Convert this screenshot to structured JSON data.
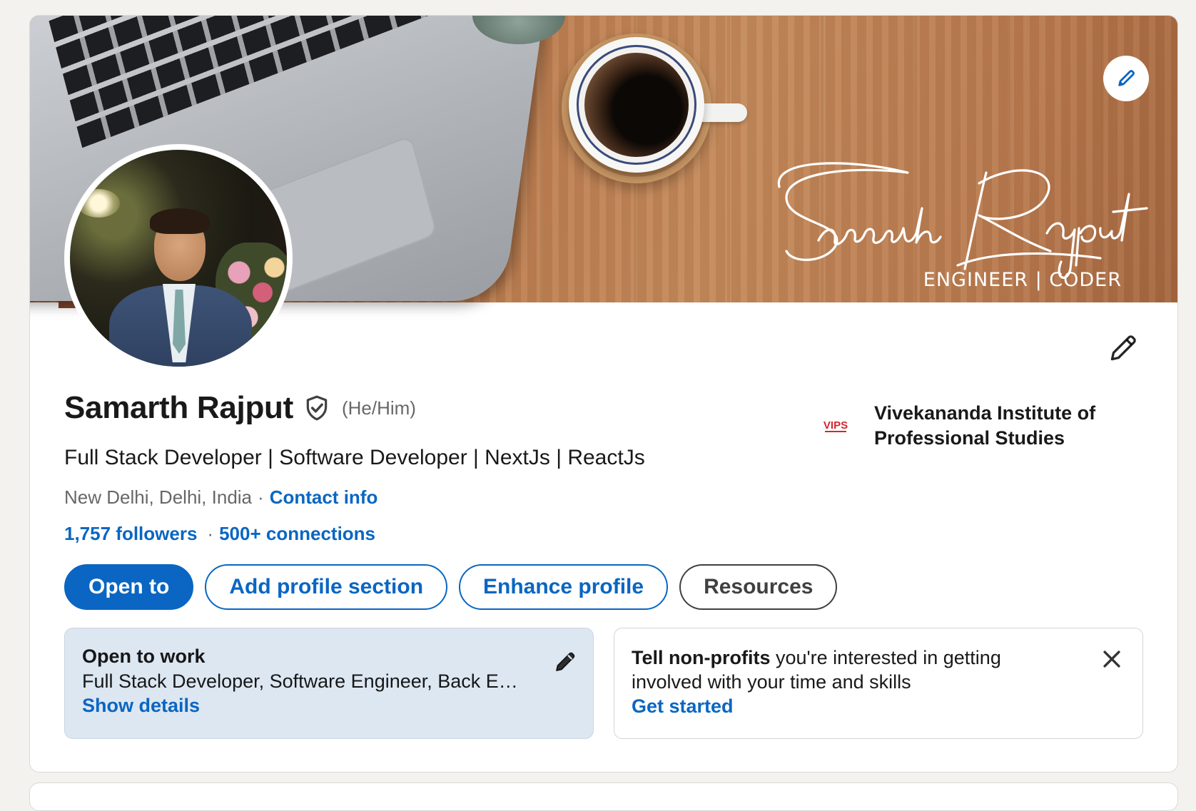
{
  "banner": {
    "signature_name": "Samarth Rajput",
    "signature_tagline": "ENGINEER | CODER",
    "edit_icon": "pencil-icon"
  },
  "profile": {
    "name": "Samarth Rajput",
    "verified_icon": "verified-shield-icon",
    "pronouns": "(He/Him)",
    "headline": "Full Stack Developer | Software Developer | NextJs | ReactJs",
    "location": "New Delhi, Delhi, India",
    "location_separator": "·",
    "contact_label": "Contact info",
    "followers_label": "1,757 followers",
    "connections_separator": "·",
    "connections_label": "500+ connections",
    "edit_icon": "pencil-icon"
  },
  "education": {
    "logo_text": "VIPS",
    "school_name": "Vivekananda Institute of Professional Studies"
  },
  "actions": {
    "open_to": "Open to",
    "add_section": "Add profile section",
    "enhance": "Enhance profile",
    "resources": "Resources"
  },
  "open_to_work": {
    "title": "Open to work",
    "roles": "Full Stack Developer, Software Engineer, Back E…",
    "link": "Show details",
    "edit_icon": "pencil-icon"
  },
  "nonprofit": {
    "strong_text": "Tell non-profits",
    "text": " you're interested in getting involved with your time and skills",
    "link": "Get started",
    "close_icon": "close-icon"
  },
  "colors": {
    "brand_blue": "#0a66c2",
    "page_bg": "#f4f2ee",
    "otw_bg": "#dde7f1"
  }
}
